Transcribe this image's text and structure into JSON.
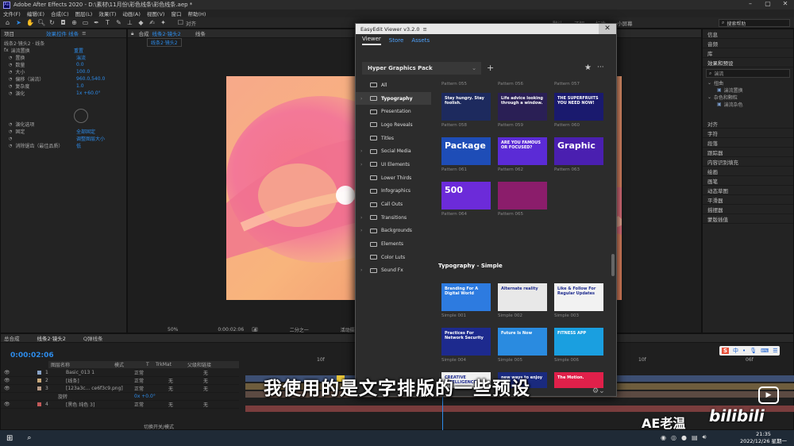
{
  "window": {
    "title": "Adobe After Effects 2020 - D:\\素材\\11月份\\彩色线条\\彩色线条.aep *",
    "logo": "Ae"
  },
  "menu": [
    "文件(F)",
    "编辑(E)",
    "合成(C)",
    "图层(L)",
    "效果(T)",
    "动画(A)",
    "视图(V)",
    "窗口",
    "帮助(H)"
  ],
  "toolbar": {
    "align_label": "对齐",
    "workspaces": [
      "默认",
      "了解",
      "标准",
      "小屏幕"
    ],
    "search_placeholder": "搜索帮助"
  },
  "project_tabs": {
    "project": "项目",
    "effect_controls": "效果控件 线条"
  },
  "effect_controls": {
    "breadcrumb": "线条2·镜头2 · 线条",
    "effect_name": "湍流置换",
    "reset": "重置",
    "props": [
      {
        "name": "置换",
        "value": "湍流"
      },
      {
        "name": "数量",
        "value": "0.0"
      },
      {
        "name": "大小",
        "value": "100.0"
      },
      {
        "name": "偏移（湍流）",
        "value": "960.0,540.0"
      },
      {
        "name": "复杂度",
        "value": "1.0"
      },
      {
        "name": "演化",
        "value": "1x +60.0°"
      },
      {
        "name": "演化选项",
        "value": ""
      },
      {
        "name": "固定",
        "value": "全部固定"
      },
      {
        "name": "",
        "value": "调整图层大小"
      },
      {
        "name": "消除锯齿（最佳品质）",
        "value": "低"
      }
    ]
  },
  "comp_tabs": {
    "label": "合成",
    "comp": "线条2·镜头2",
    "layer": "线条",
    "breadcrumb": "线条2·镜头2"
  },
  "viewer_footer": {
    "zoom": "50%",
    "time": "0:00:02:06",
    "resolution": "二分之一",
    "camera": "活动摄像机"
  },
  "right_panel": {
    "top": [
      "信息",
      "音频",
      "库"
    ],
    "effects_title": "效果和预设",
    "search_value": "湍流",
    "tree": [
      "扭曲",
      "湍流置换",
      "杂色和颗粒",
      "湍流杂色"
    ],
    "bottom": [
      "对齐",
      "字符",
      "段落",
      "跟踪器",
      "内容识别填充",
      "绘画",
      "画笔",
      "动态草图",
      "平滑器",
      "摇摆器",
      "蒙版插值"
    ]
  },
  "timeline": {
    "tabs": [
      "总合成",
      "线条2·镜头2",
      "Q弹线条"
    ],
    "timecode": "0:00:02:06",
    "cols": [
      "图层名称",
      "模式",
      "T",
      "TrkMat",
      "父级和链接"
    ],
    "layers": [
      {
        "num": "1",
        "name": "Basic_013 1",
        "mode": "正常",
        "trk": "",
        "parent": "无"
      },
      {
        "num": "2",
        "name": "[线条]",
        "mode": "正常",
        "trk": "无",
        "parent": "无"
      },
      {
        "num": "3",
        "name": "[123a3c... ce6f3c9.png]",
        "mode": "正常",
        "trk": "无",
        "parent": "无"
      },
      {
        "num": "",
        "name": "旋转",
        "mode": "",
        "trk": "",
        "parent": "0x +0.0°"
      },
      {
        "num": "4",
        "name": "[黑色 纯色 3]",
        "mode": "正常",
        "trk": "无",
        "parent": "无"
      }
    ],
    "footer": "切换开关/模式",
    "ruler": [
      "10f",
      "20f",
      "00f",
      "10f",
      "06f"
    ]
  },
  "easyedit": {
    "title": "EasyEdit Viewer v3.2.0",
    "tabs": [
      "Viewer",
      "Store",
      "Assets"
    ],
    "pack": "Hyper Graphics Pack",
    "categories": [
      "All",
      "Typography",
      "Presentation",
      "Logo Reveals",
      "Titles",
      "Social Media",
      "UI Elements",
      "Lower Thirds",
      "Infographics",
      "Call Outs",
      "Transitions",
      "Backgrounds",
      "Elements",
      "Color Luts",
      "Sound Fx"
    ],
    "top_labels": [
      "Pattern 055",
      "Pattern 056",
      "Pattern 057"
    ],
    "grid": [
      {
        "label": "Pattern 058",
        "text": "Stay hungry. Stay foolish.",
        "bg": "#1d2a5e"
      },
      {
        "label": "Pattern 059",
        "text": "Life advice looking through a window.",
        "bg": "#2a1f55"
      },
      {
        "label": "Pattern 060",
        "text": "THE SUPERFRUITS YOU NEED NOW!",
        "bg": "#1a1a6e"
      },
      {
        "label": "Pattern 061",
        "text": "Package",
        "bg": "#1e4db7"
      },
      {
        "label": "Pattern 062",
        "text": "ARE YOU FAMOUS OR FOCUSED?",
        "bg": "#5b2bd6"
      },
      {
        "label": "Pattern 063",
        "text": "Graphic",
        "bg": "#4a1fb0"
      },
      {
        "label": "Pattern 064",
        "text": "500",
        "bg": "#6c2bd9"
      },
      {
        "label": "Pattern 065",
        "text": "",
        "bg": "#8b1d6b"
      }
    ],
    "section": "Typography - Simple",
    "simple": [
      {
        "label": "Simple 001",
        "text": "Branding For A Digital World",
        "bg": "#2d7be0"
      },
      {
        "label": "Simple 002",
        "text": "Alternate reality",
        "bg": "#e8e8e8"
      },
      {
        "label": "Simple 003",
        "text": "Like & Follow For Regular Updates",
        "bg": "#f2f2f2"
      },
      {
        "label": "Simple 004",
        "text": "Practices For Network Security",
        "bg": "#1d2a8e"
      },
      {
        "label": "Simple 005",
        "text": "Future Is Now",
        "bg": "#2a8be0"
      },
      {
        "label": "Simple 006",
        "text": "FITNESS APP",
        "bg": "#1a9fe0"
      },
      {
        "label": "",
        "text": "CREATIVE INTELLIGENCE",
        "bg": "#f0f0f0"
      },
      {
        "label": "",
        "text": "new ways to enjoy",
        "bg": "#1a2a7e"
      },
      {
        "label": "",
        "text": "The Motion.",
        "bg": "#e0204a"
      }
    ]
  },
  "subtitle": "我使用的是文字排版的一些预设",
  "watermark": "AE老温",
  "bilibili": "bilibili",
  "taskbar": {
    "time": "21:35",
    "date": "2022/12/26 星期一"
  }
}
